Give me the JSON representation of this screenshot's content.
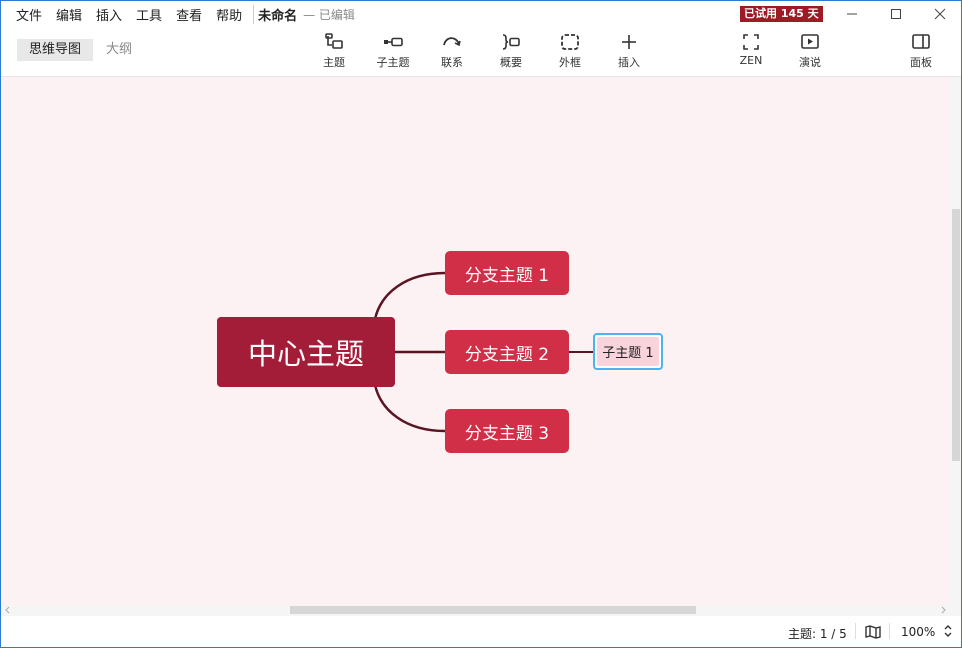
{
  "menu": [
    "文件",
    "编辑",
    "插入",
    "工具",
    "查看",
    "帮助"
  ],
  "document": {
    "title": "未命名",
    "status": "— 已编辑"
  },
  "trial_badge": "已试用 145 天",
  "view_tabs": {
    "mindmap": "思维导图",
    "outline": "大纲"
  },
  "tools": {
    "topic": "主题",
    "subtopic": "子主题",
    "relationship": "联系",
    "summary": "概要",
    "boundary": "外框",
    "insert": "插入",
    "zen": "ZEN",
    "present": "演说",
    "panel": "面板"
  },
  "mindmap": {
    "central": "中心主题",
    "branches": [
      "分支主题 1",
      "分支主题 2",
      "分支主题 3"
    ],
    "subtopic": "子主题 1"
  },
  "status": {
    "topic_count": "主题: 1 / 5",
    "zoom": "100%"
  },
  "colors": {
    "central": "#a41d38",
    "branch": "#d12e47",
    "subtopic": "#f8d3dc",
    "canvas": "#fcf2f3",
    "connector": "#5a1422",
    "selection": "#4cb3f0",
    "badge": "#9c1b24"
  }
}
